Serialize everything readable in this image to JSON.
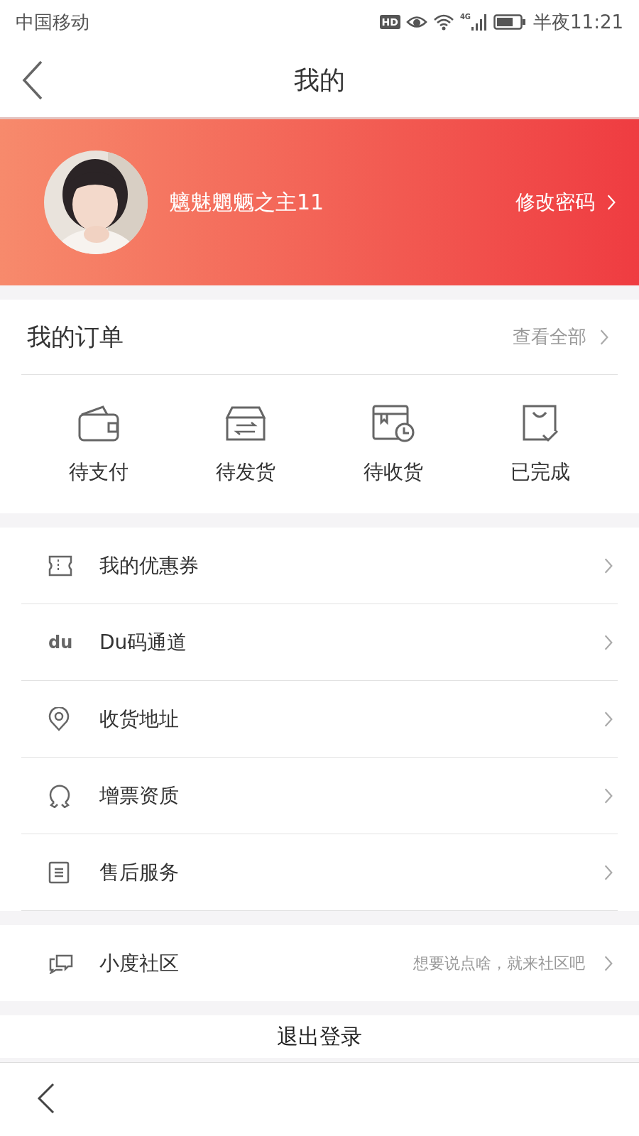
{
  "status_bar": {
    "carrier": "中国移动",
    "hd": "HD",
    "network": "4G",
    "time": "半夜11:21"
  },
  "nav": {
    "title": "我的"
  },
  "profile": {
    "username": "魑魅魍魉之主11",
    "action": "修改密码"
  },
  "orders": {
    "title": "我的订单",
    "view_all": "查看全部",
    "items": [
      {
        "kind": "wallet",
        "label": "待支付"
      },
      {
        "kind": "box",
        "label": "待发货"
      },
      {
        "kind": "clock",
        "label": "待收货"
      },
      {
        "kind": "bag",
        "label": "已完成"
      }
    ]
  },
  "menu": [
    {
      "kind": "ticket",
      "label": "我的优惠券"
    },
    {
      "kind": "text",
      "icon_text": "du",
      "label": "Du码通道"
    },
    {
      "kind": "pin",
      "label": "收货地址"
    },
    {
      "kind": "medal",
      "label": "增票资质"
    },
    {
      "kind": "doc",
      "label": "售后服务"
    }
  ],
  "community": {
    "label": "小度社区",
    "hint": "想要说点啥，就来社区吧"
  },
  "logout": "退出登录"
}
